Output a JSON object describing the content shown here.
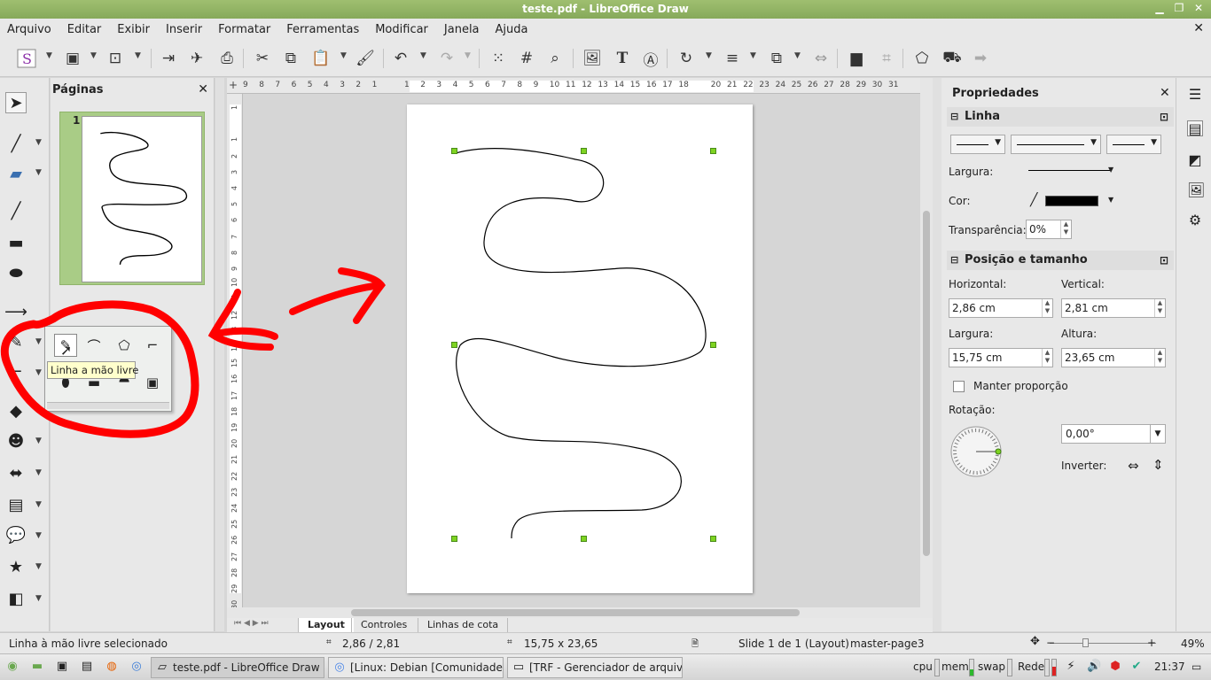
{
  "window": {
    "title": "teste.pdf - LibreOffice Draw",
    "minimize_icon": "minimize-icon",
    "restore_icon": "restore-icon",
    "close_icon": "close-icon"
  },
  "menu": [
    "Arquivo",
    "Editar",
    "Exibir",
    "Inserir",
    "Formatar",
    "Ferramentas",
    "Modificar",
    "Janela",
    "Ajuda"
  ],
  "pages_panel": {
    "title": "Páginas",
    "close": "✕",
    "page_number": "1"
  },
  "ruler": {
    "h_ticks": [
      "9",
      "8",
      "7",
      "6",
      "5",
      "4",
      "3",
      "2",
      "1",
      "",
      "1",
      "2",
      "3",
      "4",
      "5",
      "6",
      "7",
      "8",
      "9",
      "10",
      "11",
      "12",
      "13",
      "14",
      "15",
      "16",
      "17",
      "18",
      "",
      "20",
      "21",
      "22",
      "23",
      "24",
      "25",
      "26",
      "27",
      "28",
      "29",
      "30",
      "31"
    ],
    "v_ticks": [
      "1",
      "",
      "1",
      "2",
      "3",
      "4",
      "5",
      "6",
      "7",
      "8",
      "9",
      "10",
      "11",
      "12",
      "13",
      "14",
      "15",
      "16",
      "17",
      "18",
      "19",
      "20",
      "21",
      "22",
      "23",
      "24",
      "25",
      "26",
      "27",
      "28",
      "29",
      "30"
    ]
  },
  "flyout": {
    "tooltip": "Linha a mão livre"
  },
  "tabs": [
    "Layout",
    "Controles",
    "Linhas de cota"
  ],
  "properties": {
    "title": "Propriedades",
    "close": "✕",
    "line_section": "Linha",
    "width_label": "Largura:",
    "color_label": "Cor:",
    "transparency_label": "Transparência:",
    "transparency_value": "0%",
    "line_color": "#000000",
    "pos_section": "Posição e tamanho",
    "horizontal_label": "Horizontal:",
    "vertical_label": "Vertical:",
    "horizontal_value": "2,86 cm",
    "vertical_value": "2,81 cm",
    "width2_label": "Largura:",
    "height_label": "Altura:",
    "width_value": "15,75 cm",
    "height_value": "23,65 cm",
    "keep_ratio": "Manter proporção",
    "rotation_label": "Rotação:",
    "rotation_value": "0,00°",
    "flip_label": "Inverter:"
  },
  "status": {
    "message": "Linha à mão livre selecionado",
    "position": "2,86 / 2,81",
    "size": "15,75 x 23,65",
    "slide": "Slide 1 de 1 (Layout)",
    "master": "master-page3",
    "zoom": "49%"
  },
  "taskbar": {
    "tasks": [
      "teste.pdf - LibreOffice Draw",
      "[Linux: Debian [Comunidade...",
      "[TRF - Gerenciador de arquiv..."
    ],
    "cpu": "cpu",
    "mem": "mem",
    "swap": "swap",
    "net": "Rede",
    "clock": "21:37"
  },
  "colors": {
    "accent": "#8fb35f",
    "handle": "#7ed321",
    "annotation": "#ff0000",
    "thumb_bg": "#a9cc86"
  }
}
